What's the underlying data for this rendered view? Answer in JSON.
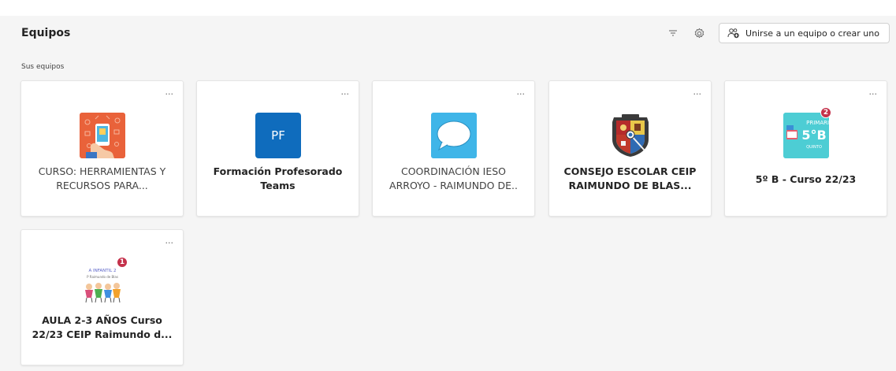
{
  "header": {
    "title": "Equipos",
    "join_label": "Unirse a un equipo o crear uno",
    "filter_icon": "filter-icon",
    "settings_icon": "gear-icon"
  },
  "section": {
    "label": "Sus equipos"
  },
  "colors": {
    "accent": "#0f6cbd",
    "badge": "#c4314b",
    "background": "#f5f5f5"
  },
  "teams": [
    {
      "name": "CURSO: HERRAMIENTAS Y RECURSOS PARA...",
      "more": "...",
      "avatar": "hand-phone-image",
      "bold": false
    },
    {
      "name": "Formación Profesorado Teams",
      "more": "...",
      "avatar_text": "PF",
      "bold": true
    },
    {
      "name": "COORDINACIÓN IESO ARROYO - RAIMUNDO DE..",
      "more": "...",
      "avatar": "speech-bubble-image",
      "bold": false
    },
    {
      "name": "CONSEJO ESCOLAR CEIP RAIMUNDO DE BLAS...",
      "more": "...",
      "avatar": "coat-of-arms-image",
      "bold": true
    },
    {
      "name": "5º B - Curso 22/23",
      "more": "...",
      "avatar": "primaria-5b-image",
      "avatar_top": "PRIMARIA",
      "avatar_main": "5°B",
      "avatar_bottom": "QUINTO",
      "badge": "2",
      "bold": true
    },
    {
      "name": "AULA 2-3 AÑOS Curso 22/23 CEIP Raimundo d...",
      "more": "...",
      "avatar": "kids-drawing-image",
      "avatar_top": "A INFANTIL 2",
      "avatar_sub": "P Raimundo de Blas",
      "badge": "1",
      "bold": true
    }
  ]
}
